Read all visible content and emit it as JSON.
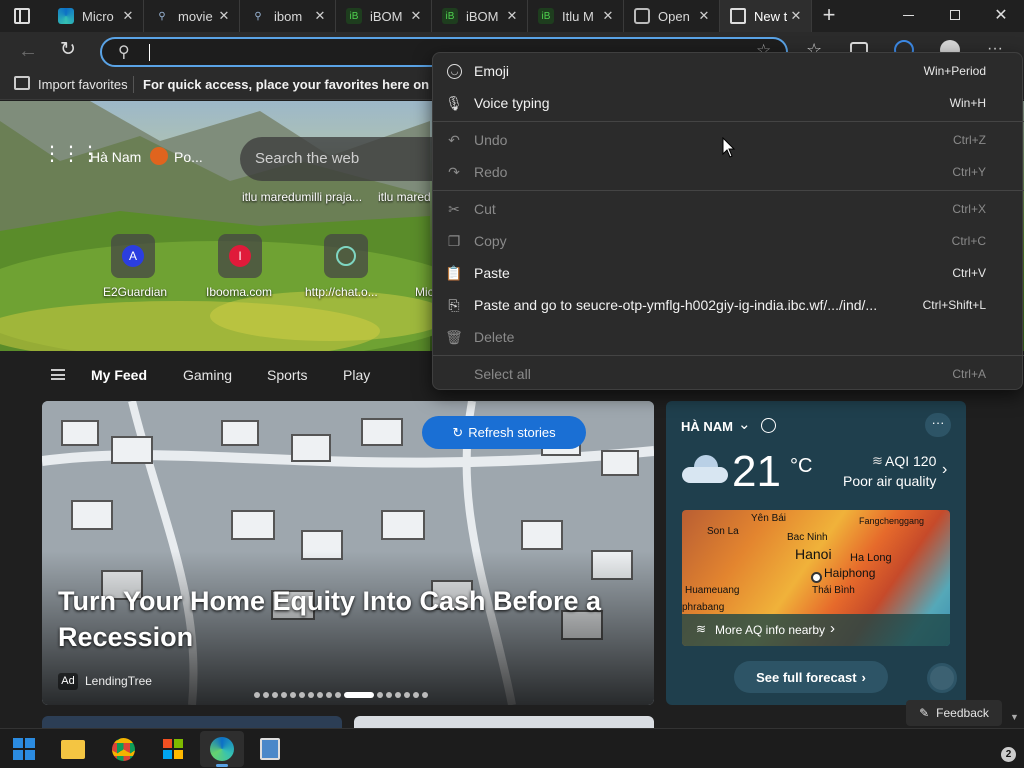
{
  "tabs": [
    {
      "title": "Micro",
      "icon": "edge-icon"
    },
    {
      "title": "movie",
      "icon": "search-icon"
    },
    {
      "title": "ibom",
      "icon": "search-icon"
    },
    {
      "title": "iBOM",
      "icon": "ibomma-icon"
    },
    {
      "title": "iBOM",
      "icon": "ibomma-icon"
    },
    {
      "title": "Itlu M",
      "icon": "ibomma-icon"
    },
    {
      "title": "Open",
      "icon": "openai-icon"
    },
    {
      "title": "New t",
      "icon": "newtab-icon"
    }
  ],
  "favorites_bar": {
    "import_label": "Import favorites",
    "hint": "For quick access, place your favorites here on the favorites bar."
  },
  "newtab": {
    "location": "Hà Nam",
    "weather_short": "Po...",
    "search_placeholder": "Search the web",
    "recent_searches": [
      "itlu maredumilli praja...",
      "itlu mared"
    ],
    "quick_links": [
      {
        "label": "E2Guardian",
        "letter": "A"
      },
      {
        "label": "Ibooma.com",
        "letter": "I"
      },
      {
        "label": "http://chat.o...",
        "letter": ""
      },
      {
        "label": "Mic",
        "letter": ""
      }
    ]
  },
  "feed_tabs": [
    "My Feed",
    "Gaming",
    "Sports",
    "Play"
  ],
  "refresh_label": "Refresh stories",
  "hero_story": {
    "title": "Turn Your Home Equity Into Cash Before a Recession",
    "ad_badge": "Ad",
    "source": "LendingTree"
  },
  "weather": {
    "location": "HÀ NAM",
    "temp": "21",
    "unit": "°C",
    "aqi": "AQI 120",
    "aqi_desc": "Poor air quality",
    "map_places": [
      "Yên Bái",
      "Son La",
      "Bac Ninh",
      "Fangchenggang",
      "Hanoi",
      "Ha Long",
      "Haiphong",
      "Huameuang",
      "Thái Bình",
      "phrabang"
    ],
    "aq_link": "More AQ info nearby",
    "forecast_btn": "See full forecast"
  },
  "feedback_label": "Feedback",
  "context_menu": [
    {
      "label": "Emoji",
      "shortcut": "Win+Period",
      "icon": "emoji-icon",
      "disabled": false
    },
    {
      "label": "Voice typing",
      "shortcut": "Win+H",
      "icon": "microphone-icon",
      "disabled": false
    },
    {
      "label": "Undo",
      "shortcut": "Ctrl+Z",
      "icon": "undo-icon",
      "disabled": true
    },
    {
      "label": "Redo",
      "shortcut": "Ctrl+Y",
      "icon": "redo-icon",
      "disabled": true
    },
    {
      "label": "Cut",
      "shortcut": "Ctrl+X",
      "icon": "scissors-icon",
      "disabled": true
    },
    {
      "label": "Copy",
      "shortcut": "Ctrl+C",
      "icon": "copy-icon",
      "disabled": true
    },
    {
      "label": "Paste",
      "shortcut": "Ctrl+V",
      "icon": "paste-icon",
      "disabled": false
    },
    {
      "label": "Paste and go to seucre-otp-ymflg-h002giy-ig-india.ibc.wf/.../ind/...",
      "shortcut": "Ctrl+Shift+L",
      "icon": "paste-go-icon",
      "disabled": false
    },
    {
      "label": "Delete",
      "shortcut": "",
      "icon": "trash-icon",
      "disabled": true
    },
    {
      "label": "Select all",
      "shortcut": "Ctrl+A",
      "icon": "",
      "disabled": true
    }
  ],
  "taskbar_badge": "2",
  "colors": {
    "accent": "#5aa3e6",
    "refresh": "#1a6fd4"
  }
}
